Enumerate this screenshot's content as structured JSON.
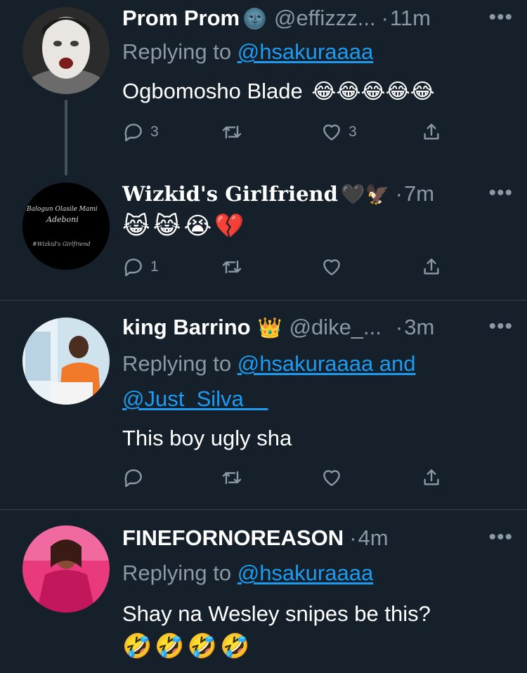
{
  "tweets": [
    {
      "name": "Prom Prom",
      "name_emoji": "🌚",
      "handle": "@effizzz...",
      "time": "11m",
      "more": "•••",
      "replying_label": "Replying to",
      "mentions_line1": "@hsakuraaaa",
      "mentions_line2": "",
      "text": "Ogbomosho Blade",
      "text_emoji": "😂😂😂😂😂",
      "emoji_line": "",
      "reply_count": "3",
      "retweet_count": "",
      "like_count": "3",
      "avatar_colors": [
        "#2b2b2b",
        "#e9e6e2"
      ]
    },
    {
      "name": "Wizkid's Girlfriend",
      "name_emoji": "🖤🦅",
      "handle": "",
      "time": "7m",
      "more": "•••",
      "replying_label": "",
      "mentions_line1": "",
      "mentions_line2": "",
      "text": "",
      "text_emoji": "",
      "emoji_line": "😹😹😭💔",
      "reply_count": "1",
      "retweet_count": "",
      "like_count": "",
      "avatar_colors": [
        "#000000",
        "#ffffff"
      ]
    },
    {
      "name": "king Barrino",
      "name_emoji": "👑",
      "handle": "@dike_...",
      "time": "3m",
      "more": "•••",
      "replying_label": "Replying to",
      "mentions_line1": "@hsakuraaaa and",
      "mentions_line2": "@Just_Silva__",
      "text": "This boy ugly sha",
      "text_emoji": "",
      "emoji_line": "",
      "reply_count": "",
      "retweet_count": "",
      "like_count": "",
      "avatar_colors": [
        "#cfe3ef",
        "#f07a2a"
      ]
    },
    {
      "name": "FINEFORNOREASON",
      "name_emoji": "",
      "handle": "",
      "time": "4m",
      "more": "•••",
      "replying_label": "Replying to",
      "mentions_line1": "@hsakuraaaa",
      "mentions_line2": "",
      "text": "Shay na Wesley snipes be this?",
      "text_emoji": "",
      "emoji_line": "🤣🤣🤣🤣",
      "reply_count": "",
      "retweet_count": "",
      "like_count": "",
      "avatar_colors": [
        "#e83a7c",
        "#c2185b"
      ]
    }
  ],
  "wizkid_avatar_text": {
    "line1": "Balogun Olasile Mami",
    "line2": "Adeboni",
    "line3": "#Wizkid's Girlfriend"
  },
  "colors": {
    "background": "#15202b",
    "secondary_text": "#8b98a5",
    "link": "#1d9bf0",
    "divider": "#38444d"
  }
}
